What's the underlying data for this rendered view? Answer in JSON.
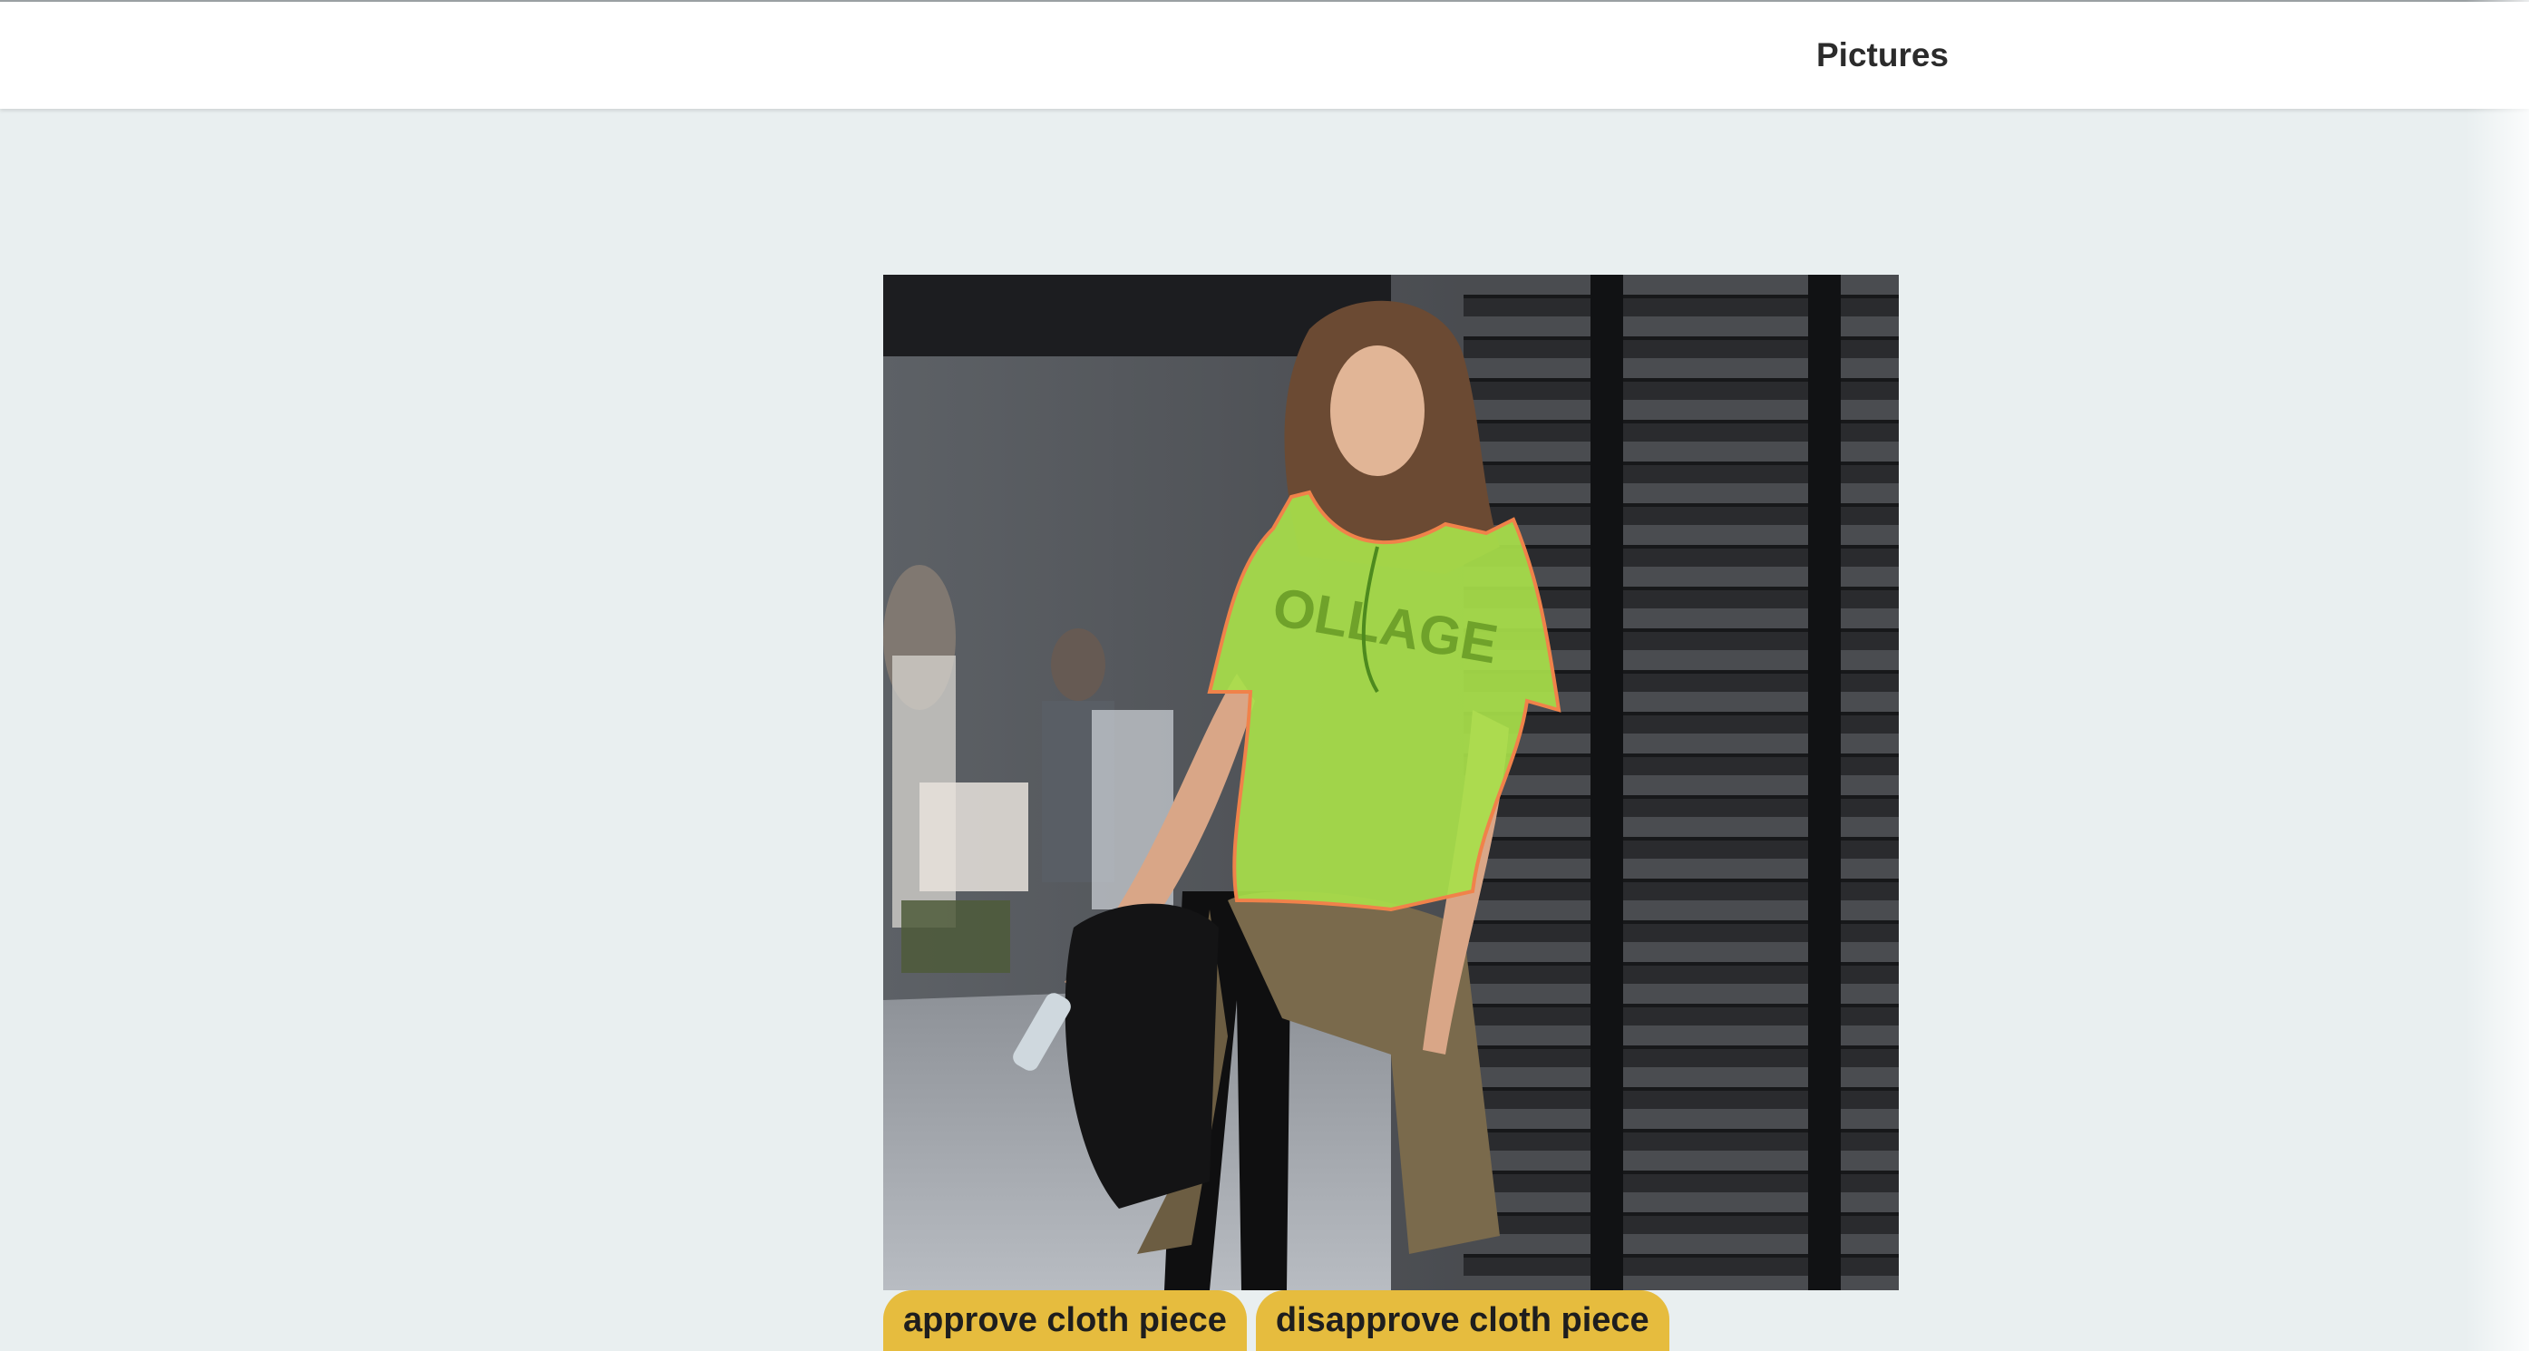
{
  "header": {
    "nav_pictures_label": "Pictures"
  },
  "photo": {
    "shirt_print_text": "OLLAGE",
    "overlay_color": "#a8e04a",
    "outline_color": "#f0824a"
  },
  "actions": {
    "approve_label": "approve cloth piece",
    "disapprove_label": "disapprove cloth piece"
  },
  "colors": {
    "page_background": "#e9eff0",
    "header_background": "#ffffff",
    "button_background": "#e6bc3e"
  }
}
